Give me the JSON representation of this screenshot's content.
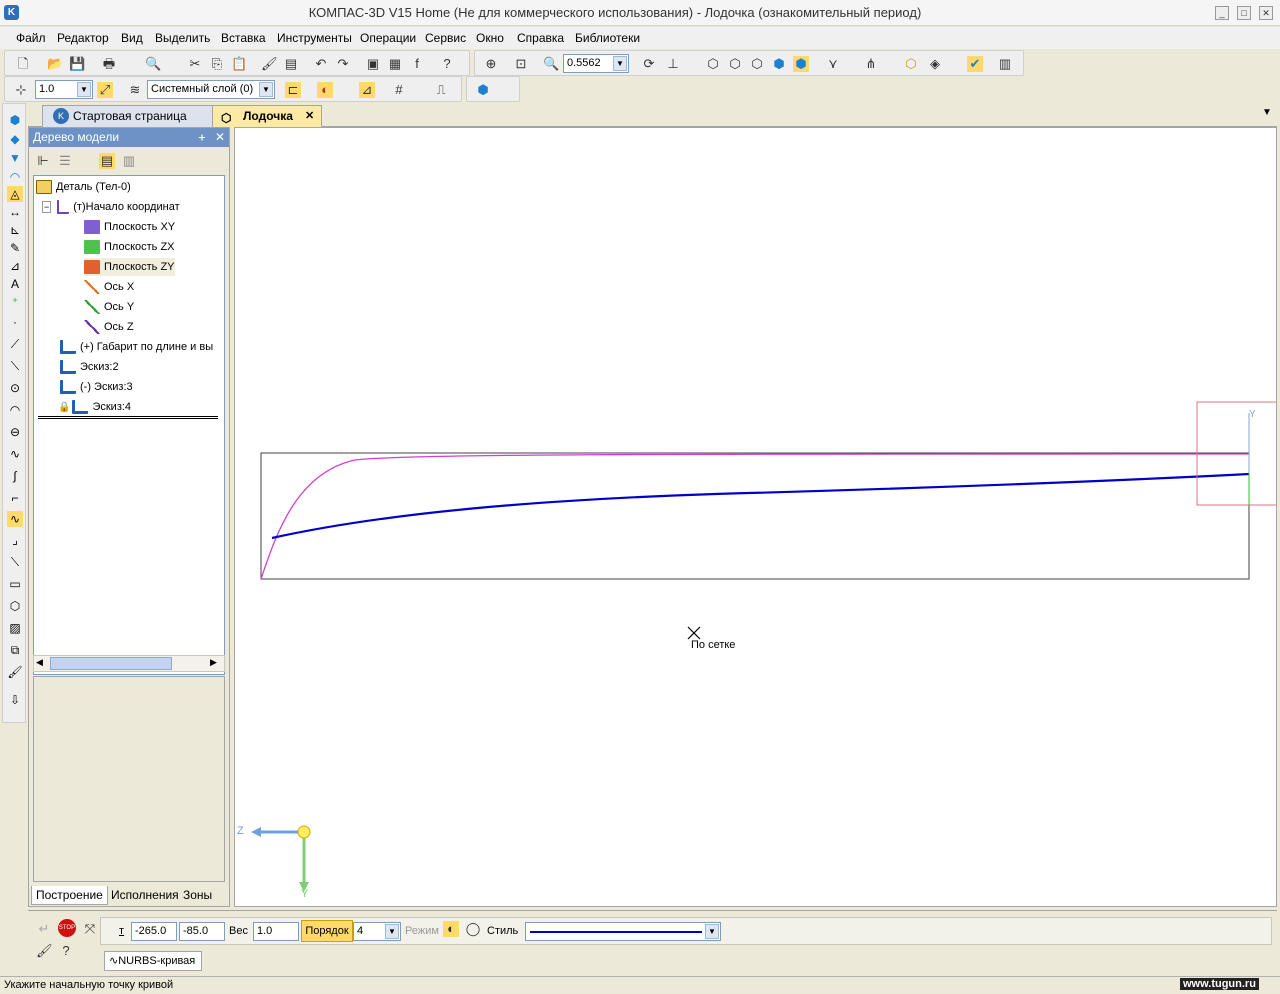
{
  "window": {
    "title": "КОМПАС-3D V15 Home (Не для коммерческого использования) - Лодочка (ознакомительный период)",
    "min": "_",
    "max": "□",
    "close": "✕"
  },
  "menu": [
    "Файл",
    "Редактор",
    "Вид",
    "Выделить",
    "Вставка",
    "Инструменты",
    "Операции",
    "Сервис",
    "Окно",
    "Справка",
    "Библиотеки"
  ],
  "toolbar": {
    "zoom_value": "0.5562",
    "step_value": "1.0",
    "layer_value": "Системный слой (0)"
  },
  "tabs": {
    "start": "Стартовая страница",
    "doc": "Лодочка",
    "doc_close": "✕",
    "more": "▼"
  },
  "panel": {
    "title": "Дерево модели",
    "pin": "ᚐ",
    "close": "✕",
    "tree": [
      {
        "label": "Деталь (Тел-0)"
      },
      {
        "label": "(т)Начало координат"
      },
      {
        "label": "Плоскость XY"
      },
      {
        "label": "Плоскость ZX"
      },
      {
        "label": "Плоскость ZY"
      },
      {
        "label": "Ось X"
      },
      {
        "label": "Ось Y"
      },
      {
        "label": "Ось Z"
      },
      {
        "label": "(+) Габарит по длине и вы"
      },
      {
        "label": "Эскиз:2"
      },
      {
        "label": "(-) Эскиз:3"
      },
      {
        "label": "Эскиз:4"
      }
    ],
    "bottom_tabs": [
      "Построение",
      "Исполнения",
      "Зоны"
    ]
  },
  "canvas": {
    "cursor_hint": "По сетке",
    "axis_z": "Z",
    "axis_y": "Y",
    "axis_y_small": "Y"
  },
  "props": {
    "t_label": "т",
    "x": "-265.0",
    "y": "-85.0",
    "weight_label": "Вес",
    "weight": "1.0",
    "order_label": "Порядок",
    "order": "4",
    "mode_label": "Режим",
    "style_label": "Стиль",
    "tool_name": "NURBS-кривая"
  },
  "status": {
    "hint": "Укажите начальную точку кривой",
    "watermark": "www.tugun.ru"
  },
  "colors": {
    "curve_blue": "#0000c8",
    "curve_magenta": "#d040d0",
    "rect": "#404040",
    "selection": "#e07080"
  }
}
